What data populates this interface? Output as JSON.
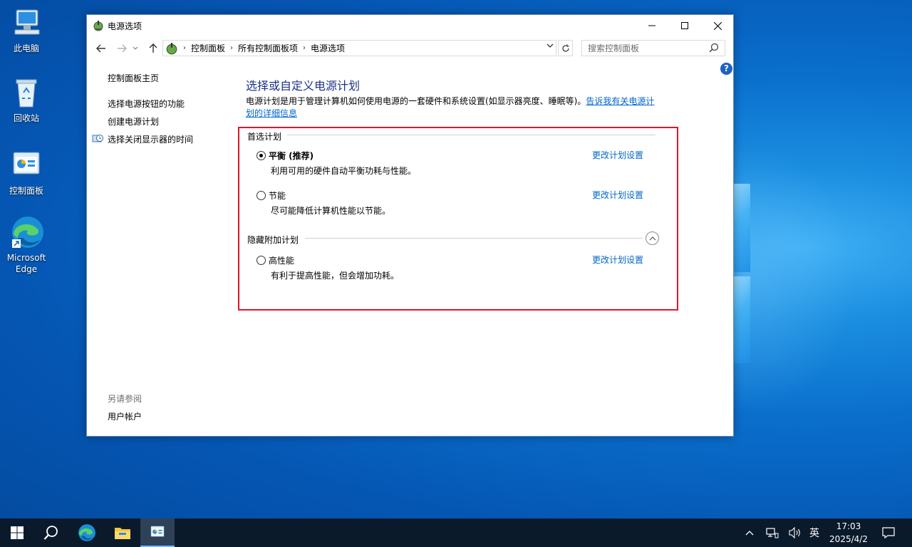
{
  "desktop": {
    "icons": [
      {
        "label": "此电脑"
      },
      {
        "label": "回收站"
      },
      {
        "label": "控制面板"
      },
      {
        "label": "Microsoft Edge"
      }
    ]
  },
  "window": {
    "title": "电源选项",
    "nav": {
      "breadcrumbs": [
        "控制面板",
        "所有控制面板项",
        "电源选项"
      ],
      "search_placeholder": "搜索控制面板"
    },
    "sidebar": {
      "home": "控制面板主页",
      "links": [
        "选择电源按钮的功能",
        "创建电源计划",
        "选择关闭显示器的时间"
      ],
      "see_also_header": "另请参阅",
      "see_also_links": [
        "用户帐户"
      ]
    },
    "main": {
      "title": "选择或自定义电源计划",
      "description": "电源计划是用于管理计算机如何使用电源的一套硬件和系统设置(如显示器亮度、睡眠等)。",
      "description_link": "告诉我有关电源计划的详细信息",
      "preferred_header": "首选计划",
      "hidden_header": "隐藏附加计划",
      "change_link": "更改计划设置",
      "plans": [
        {
          "name": "平衡 (推荐)",
          "desc": "利用可用的硬件自动平衡功耗与性能。",
          "selected": true
        },
        {
          "name": "节能",
          "desc": "尽可能降低计算机性能以节能。",
          "selected": false
        },
        {
          "name": "高性能",
          "desc": "有利于提高性能，但会增加功耗。",
          "selected": false
        }
      ]
    }
  },
  "taskbar": {
    "ime": "英",
    "time": "17:03",
    "date": "2025/4/2"
  },
  "colors": {
    "link": "#0066cc",
    "title_blue": "#1e3287",
    "highlight_border": "#e0162b"
  }
}
